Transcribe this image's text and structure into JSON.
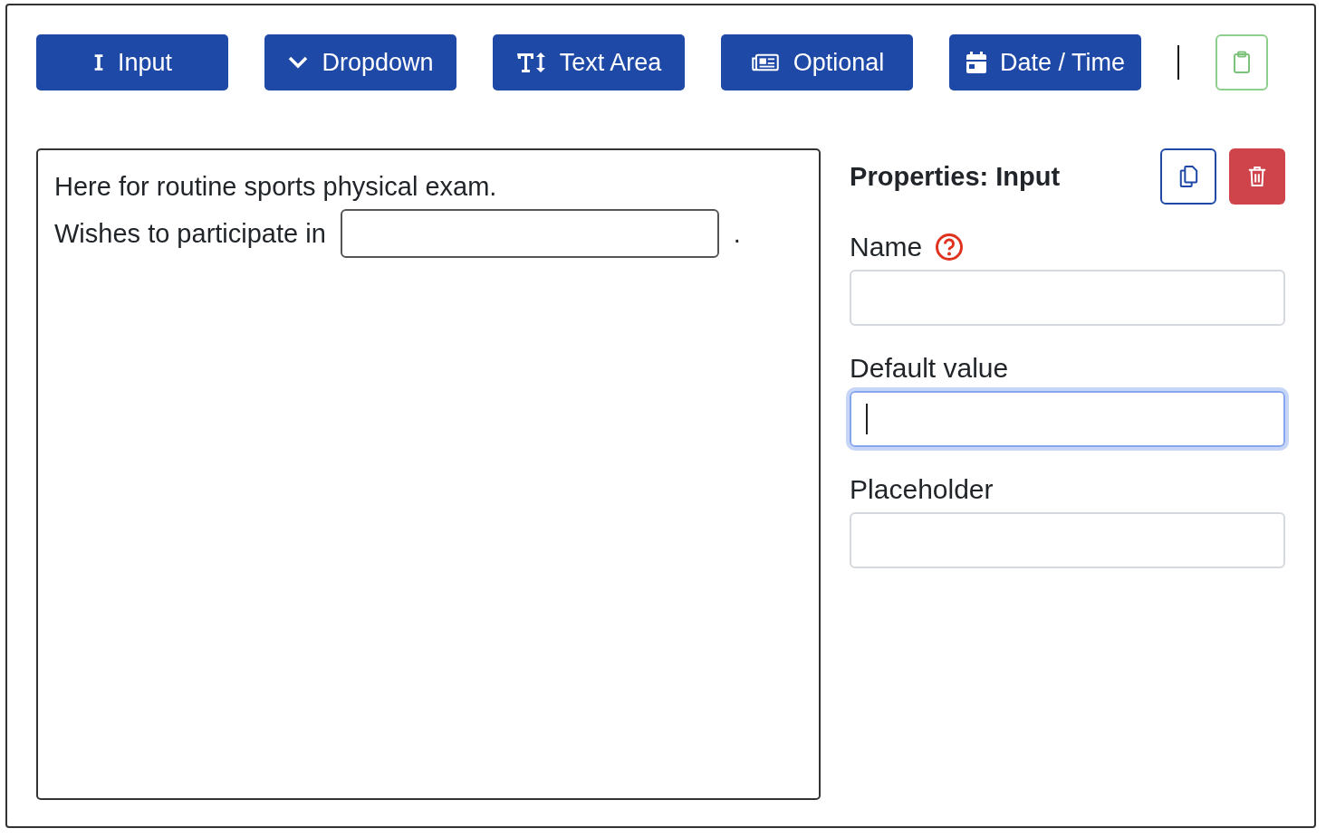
{
  "toolbar": {
    "buttons": [
      {
        "label": "Input",
        "kind": "input"
      },
      {
        "label": "Dropdown",
        "kind": "dropdown"
      },
      {
        "label": "Text Area",
        "kind": "textarea"
      },
      {
        "label": "Optional",
        "kind": "optional"
      },
      {
        "label": "Date / Time",
        "kind": "datetime"
      }
    ]
  },
  "editor": {
    "lines": [
      {
        "kind": "text",
        "text": "Here for routine sports physical exam."
      },
      {
        "kind": "blank",
        "before": "Wishes to participate in",
        "after": "."
      }
    ]
  },
  "properties": {
    "title": "Properties: Input",
    "fields": [
      {
        "label": "Name",
        "help": true,
        "focused": false
      },
      {
        "label": "Default value",
        "help": false,
        "focused": true
      },
      {
        "label": "Placeholder",
        "help": false,
        "focused": false
      }
    ]
  }
}
